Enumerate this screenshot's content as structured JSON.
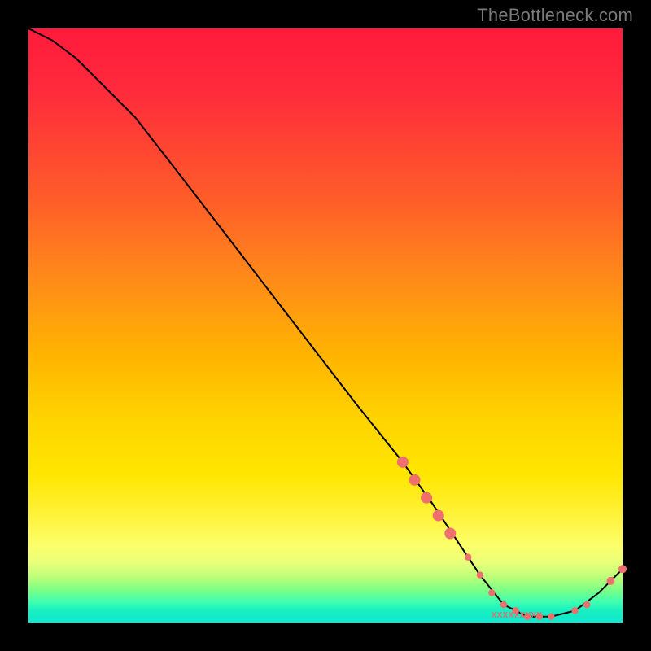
{
  "watermark": "TheBottleneck.com",
  "label": {
    "text": "XXXXXXXXX"
  },
  "colors": {
    "marker": "#ef6e6e",
    "curve": "#000000"
  },
  "chart_data": {
    "type": "line",
    "title": "",
    "xlabel": "",
    "ylabel": "",
    "xlim": [
      0,
      100
    ],
    "ylim": [
      0,
      100
    ],
    "grid": false,
    "series": [
      {
        "name": "bottleneck-curve",
        "x": [
          0,
          4,
          8,
          12,
          18,
          25,
          35,
          45,
          55,
          63,
          68,
          72,
          76,
          80,
          84,
          88,
          92,
          96,
          100
        ],
        "y": [
          100,
          98,
          95,
          91,
          85,
          76,
          63,
          50,
          37,
          27,
          20,
          14,
          8,
          3,
          1,
          1,
          2,
          5,
          9
        ]
      }
    ],
    "markers": {
      "name": "highlighted-points",
      "x": [
        63,
        65,
        67,
        69,
        71,
        74,
        76,
        78,
        80,
        82,
        84,
        86,
        88,
        92,
        94,
        98,
        100
      ],
      "y": [
        27,
        24,
        21,
        18,
        15,
        11,
        8,
        5,
        3,
        2,
        1,
        1,
        1,
        2,
        3,
        7,
        9
      ]
    },
    "annotations": [
      {
        "text": "XXXXXXXXX",
        "x": 82,
        "y": 1
      }
    ]
  }
}
